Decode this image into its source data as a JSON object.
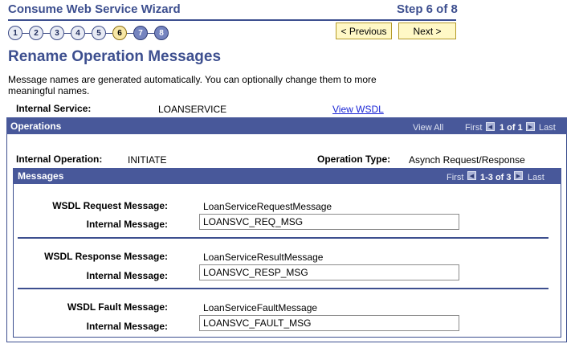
{
  "header": {
    "wizard_title": "Consume Web Service Wizard",
    "step_text": "Step 6 of 8"
  },
  "steps": [
    "1",
    "2",
    "3",
    "4",
    "5",
    "6",
    "7",
    "8"
  ],
  "current_step": 6,
  "buttons": {
    "previous": "< Previous",
    "next": "Next >"
  },
  "page": {
    "title": "Rename Operation Messages",
    "instructions": "Message names are generated automatically. You can optionally change them to more meaningful names."
  },
  "service": {
    "label": "Internal Service:",
    "value": "LOANSERVICE",
    "view_wsdl": "View WSDL"
  },
  "operations": {
    "title": "Operations",
    "view_all": "View All",
    "first": "First",
    "count": "1 of 1",
    "last": "Last",
    "internal_operation_label": "Internal Operation:",
    "internal_operation_value": "INITIATE",
    "operation_type_label": "Operation Type:",
    "operation_type_value": "Asynch Request/Response"
  },
  "messages": {
    "title": "Messages",
    "first": "First",
    "count": "1-3 of 3",
    "last": "Last",
    "internal_label": "Internal Message:",
    "rows": [
      {
        "wsdl_label": "WSDL Request Message:",
        "wsdl_value": "LoanServiceRequestMessage",
        "internal_value": "LOANSVC_REQ_MSG"
      },
      {
        "wsdl_label": "WSDL Response Message:",
        "wsdl_value": "LoanServiceResultMessage",
        "internal_value": "LOANSVC_RESP_MSG"
      },
      {
        "wsdl_label": "WSDL Fault Message:",
        "wsdl_value": "LoanServiceFaultMessage",
        "internal_value": "LOANSVC_FAULT_MSG"
      }
    ]
  },
  "colors": {
    "brand": "#3d4f8f",
    "grid_header": "#48589a",
    "button_bg": "#fff8c6",
    "current_step": "#f7e7a6",
    "link": "#1a25d6"
  }
}
